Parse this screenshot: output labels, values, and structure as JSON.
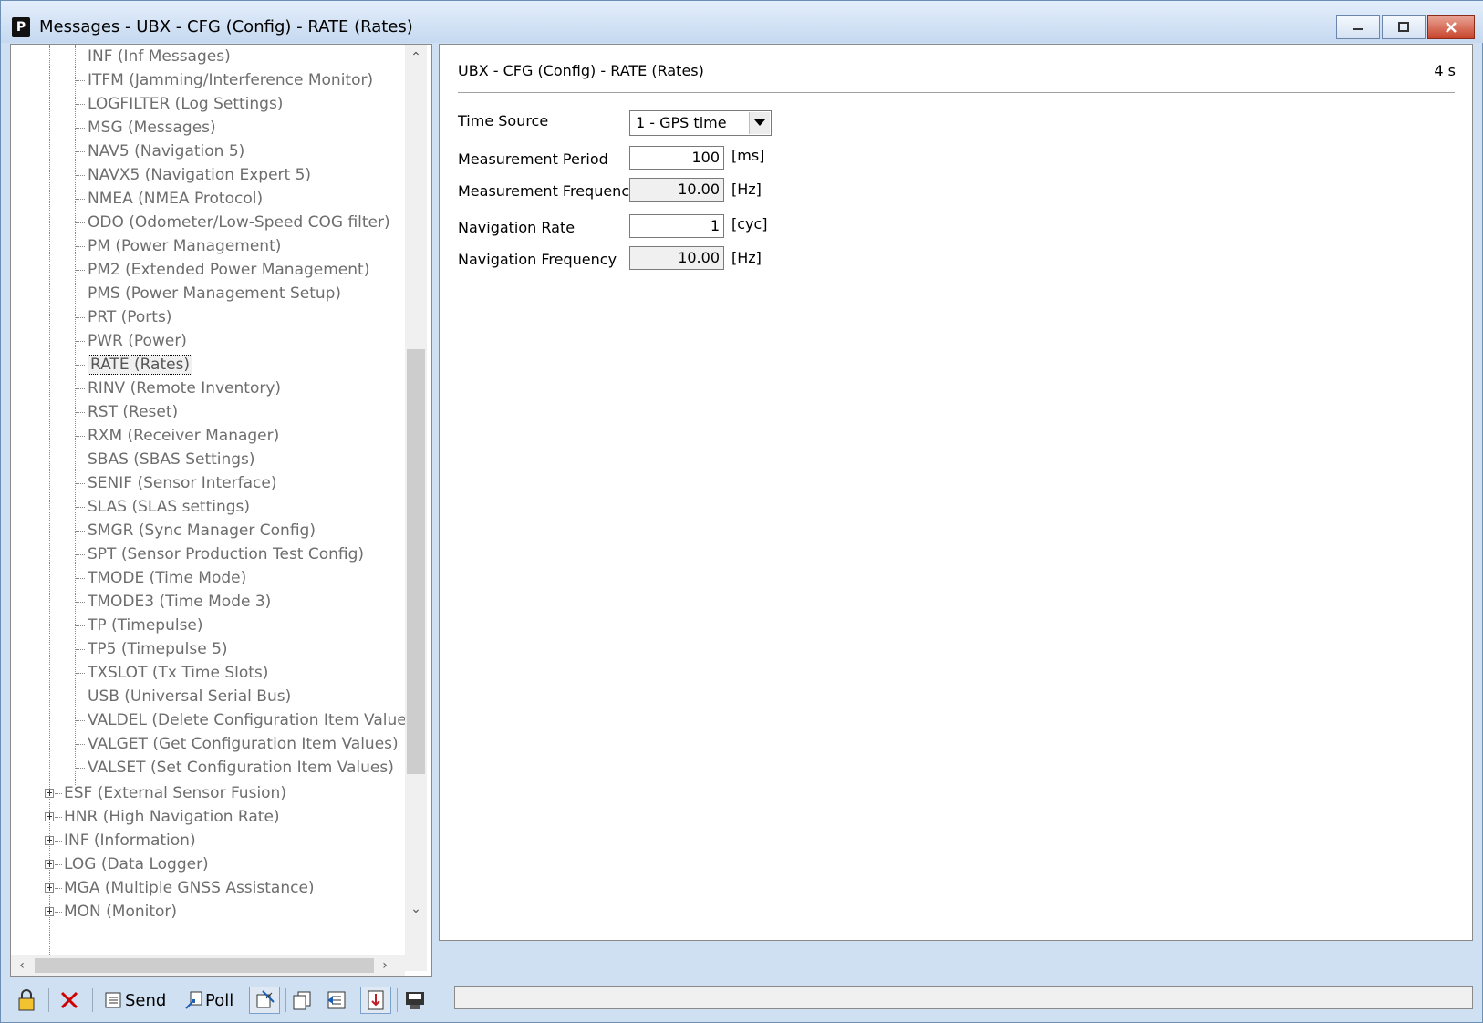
{
  "window": {
    "title": "Messages - UBX - CFG (Config) - RATE (Rates)"
  },
  "tree": {
    "children": [
      "INF (Inf Messages)",
      "ITFM (Jamming/Interference Monitor)",
      "LOGFILTER (Log Settings)",
      "MSG (Messages)",
      "NAV5 (Navigation 5)",
      "NAVX5 (Navigation Expert 5)",
      "NMEA (NMEA Protocol)",
      "ODO (Odometer/Low-Speed COG filter)",
      "PM (Power Management)",
      "PM2 (Extended Power Management)",
      "PMS (Power Management Setup)",
      "PRT (Ports)",
      "PWR (Power)",
      "RATE (Rates)",
      "RINV (Remote Inventory)",
      "RST (Reset)",
      "RXM (Receiver Manager)",
      "SBAS (SBAS Settings)",
      "SENIF (Sensor Interface)",
      "SLAS (SLAS settings)",
      "SMGR (Sync Manager Config)",
      "SPT (Sensor Production Test Config)",
      "TMODE (Time Mode)",
      "TMODE3 (Time Mode 3)",
      "TP (Timepulse)",
      "TP5 (Timepulse 5)",
      "TXSLOT (Tx Time Slots)",
      "USB (Universal Serial Bus)",
      "VALDEL (Delete Configuration Item Values)",
      "VALGET (Get Configuration Item Values)",
      "VALSET (Set Configuration Item Values)"
    ],
    "selected": "RATE (Rates)",
    "groups": [
      "ESF (External Sensor Fusion)",
      "HNR (High Navigation Rate)",
      "INF (Information)",
      "LOG (Data Logger)",
      "MGA (Multiple GNSS Assistance)",
      "MON (Monitor)"
    ]
  },
  "panel": {
    "title": "UBX - CFG (Config) - RATE (Rates)",
    "age": "4 s",
    "time_source": {
      "label": "Time Source",
      "value": "1 - GPS time"
    },
    "meas_period": {
      "label": "Measurement Period",
      "value": "100",
      "unit": "[ms]"
    },
    "meas_freq": {
      "label": "Measurement Frequency",
      "value": "10.00",
      "unit": "[Hz]"
    },
    "nav_rate": {
      "label": "Navigation Rate",
      "value": "1",
      "unit": "[cyc]"
    },
    "nav_freq": {
      "label": "Navigation Frequency",
      "value": "10.00",
      "unit": "[Hz]"
    }
  },
  "toolbar": {
    "send": "Send",
    "poll": "Poll"
  }
}
